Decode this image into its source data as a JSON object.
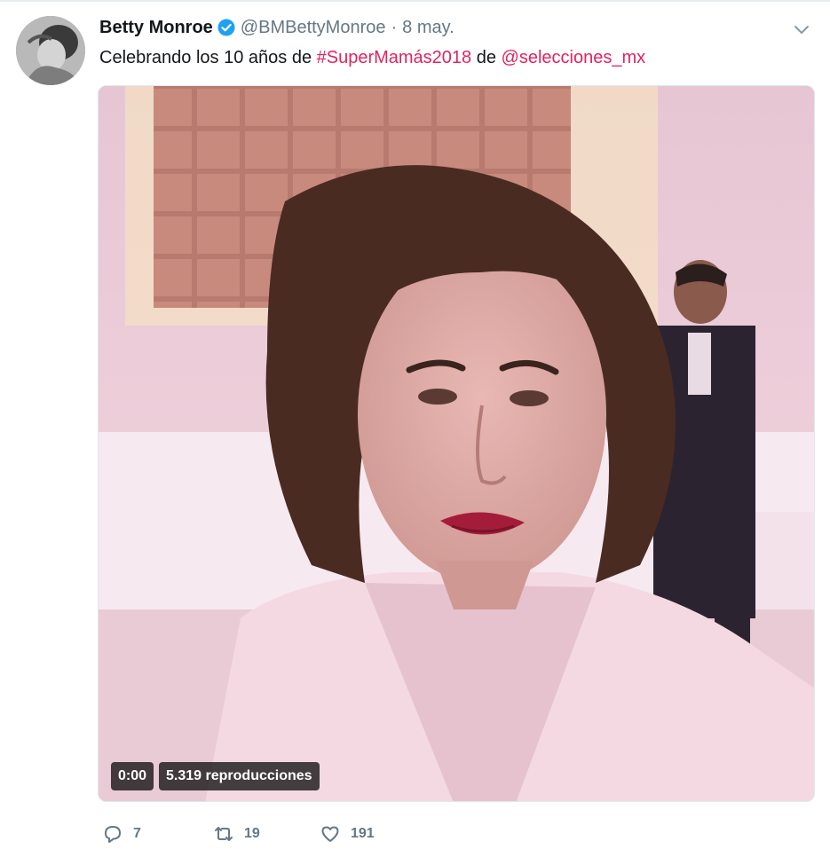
{
  "tweet": {
    "author_name": "Betty Monroe",
    "handle": "@BMBettyMonroe",
    "separator": "·",
    "date": "8 may.",
    "text_prefix": "Celebrando los 10 años de ",
    "hashtag": "#SuperMamás2018",
    "text_middle": " de ",
    "mention": "@selecciones_mx"
  },
  "video": {
    "time": "0:00",
    "views": "5.319 reproducciones"
  },
  "actions": {
    "replies": "7",
    "retweets": "19",
    "likes": "191"
  },
  "icons": {
    "verified": "verified-badge-icon",
    "caret": "chevron-down-icon",
    "reply": "reply-icon",
    "retweet": "retweet-icon",
    "like": "heart-icon"
  },
  "colors": {
    "link": "#e0245e",
    "verified": "#1da1f2",
    "muted": "#657786",
    "text": "#14171a"
  }
}
